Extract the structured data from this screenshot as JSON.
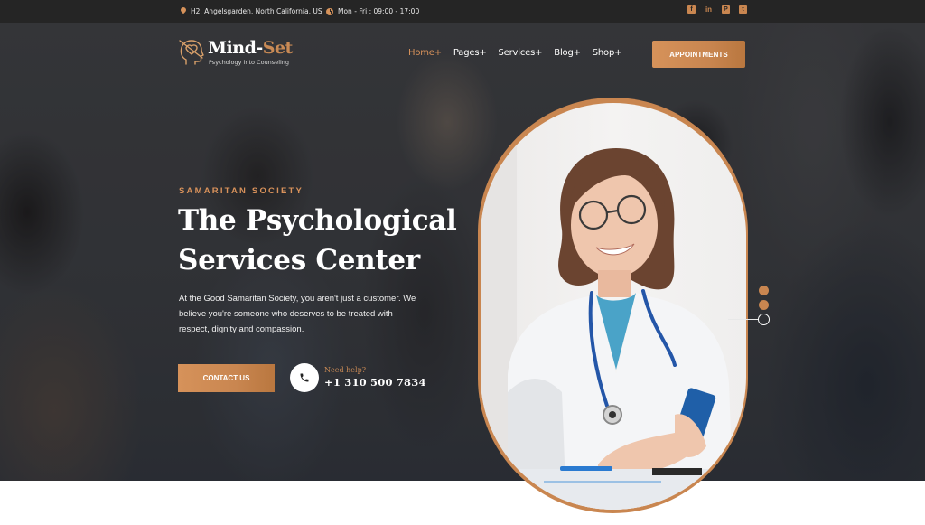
{
  "topbar": {
    "address": "H2, Angelsgarden, North California, US",
    "hours": "Mon - Fri : 09:00 - 17:00",
    "socials": [
      {
        "name": "facebook-icon",
        "glyph": "f"
      },
      {
        "name": "linkedin-icon",
        "glyph": "in"
      },
      {
        "name": "pinterest-icon",
        "glyph": "P"
      },
      {
        "name": "twitter-icon",
        "glyph": "t"
      }
    ]
  },
  "brand": {
    "name_main": "Mind-",
    "name_accent": "Set",
    "tagline": "Psychology into Counseling"
  },
  "nav": {
    "items": [
      {
        "label": "Home+",
        "active": true
      },
      {
        "label": "Pages+",
        "active": false
      },
      {
        "label": "Services+",
        "active": false
      },
      {
        "label": "Blog+",
        "active": false
      },
      {
        "label": "Shop+",
        "active": false
      }
    ],
    "cta": "APPOINTMENTS"
  },
  "hero": {
    "eyebrow": "SAMARITAN SOCIETY",
    "headline_line1": "The Psychological",
    "headline_line2": "Services Center",
    "description": "At the Good Samaritan Society, you aren't just a customer. We believe you're someone who deserves to be treated with respect, dignity and compassion.",
    "contact_button": "CONTACT US",
    "help_label": "Need help?",
    "phone": "+1 310 500 7834"
  },
  "slider": {
    "total": 3,
    "active_index": 2
  },
  "colors": {
    "accent": "#c98650",
    "topbar_bg": "#252525",
    "hero_overlay": "#3a3b3e"
  }
}
